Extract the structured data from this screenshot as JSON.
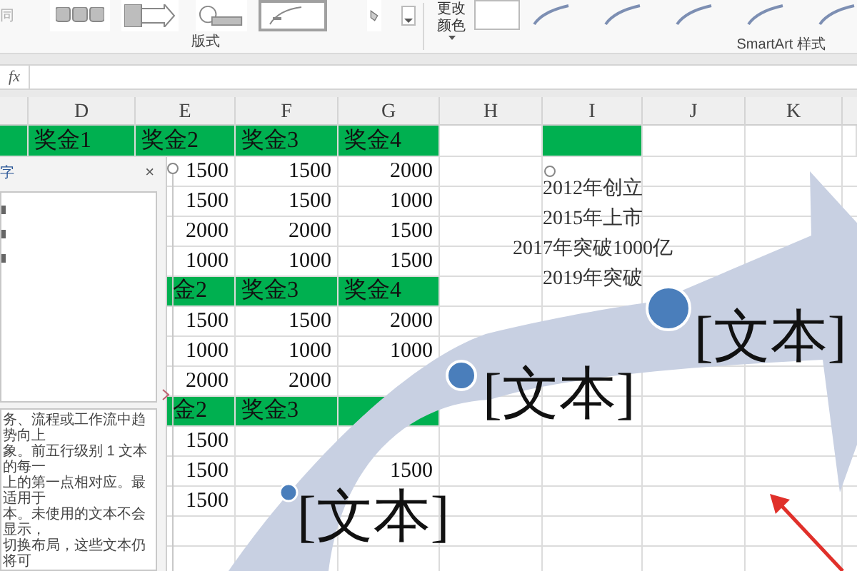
{
  "ribbon": {
    "left_item": "同",
    "layout_gallery": [
      {
        "kind": "blocks",
        "selected": false
      },
      {
        "kind": "arrow",
        "selected": false
      },
      {
        "kind": "circle",
        "selected": false
      },
      {
        "kind": "curve",
        "selected": true
      },
      {
        "kind": "small",
        "selected": false
      }
    ],
    "change_colors": "更改颜色",
    "groups": [
      {
        "label": "版式"
      },
      {
        "label": "SmartArt 样式"
      }
    ]
  },
  "formula_bar": {
    "function_label": "fx"
  },
  "sheet": {
    "columns": [
      "D",
      "E",
      "F",
      "G",
      "H",
      "I",
      "J",
      "K"
    ],
    "top_row": {
      "kind": "header",
      "cells": [
        {
          "highlighted": true
        },
        {
          "text": "奖金1",
          "highlighted": true
        },
        {
          "text": "奖金2",
          "highlighted": true
        },
        {
          "text": "奖金3",
          "highlighted": true
        },
        {
          "text": "奖金4",
          "highlighted": true
        },
        {
          "highlighted": false
        },
        {
          "highlighted": true
        },
        {
          "highlighted": false
        },
        {
          "highlighted": false
        },
        {
          "highlighted": false
        }
      ]
    },
    "rows": [
      {
        "kind": "data",
        "cells": [
          "1500",
          "1500",
          "2000"
        ]
      },
      {
        "kind": "data",
        "cells": [
          "1500",
          "1500",
          "1000"
        ]
      },
      {
        "kind": "data",
        "cells": [
          "2000",
          "2000",
          "1500"
        ]
      },
      {
        "kind": "data",
        "cells": [
          "1000",
          "1000",
          "1500"
        ]
      },
      {
        "kind": "header",
        "cells": [
          "金2",
          "奖金3",
          "奖金4"
        ]
      },
      {
        "kind": "data",
        "cells": [
          "1500",
          "1500",
          "2000"
        ]
      },
      {
        "kind": "data",
        "cells": [
          "1000",
          "1000",
          "1000"
        ]
      },
      {
        "kind": "data",
        "cells": [
          "2000",
          "2000"
        ]
      },
      {
        "kind": "header",
        "cells": [
          "金2",
          "奖金3"
        ]
      },
      {
        "kind": "data",
        "cells": [
          "1500"
        ]
      },
      {
        "kind": "data",
        "cells": [
          "1500",
          null,
          "1500"
        ]
      },
      {
        "kind": "data",
        "cells": [
          "1500"
        ]
      },
      {
        "kind": "data"
      }
    ]
  },
  "task_pane": {
    "title": "字",
    "close": "×",
    "description_lines": [
      "务、流程或工作流中趋势向上",
      "象。前五行级别 1 文本的每一",
      "上的第一点相对应。最适用于",
      "本。未使用的文本不会显示，",
      "切换布局，这些文本仍将可"
    ]
  },
  "smartart": {
    "milestones": [
      "2012年创立",
      "2015年上市",
      "2017年突破1000亿",
      "2019年突破"
    ],
    "items": [
      "[文本]",
      "[文本]",
      "[文本]"
    ]
  }
}
